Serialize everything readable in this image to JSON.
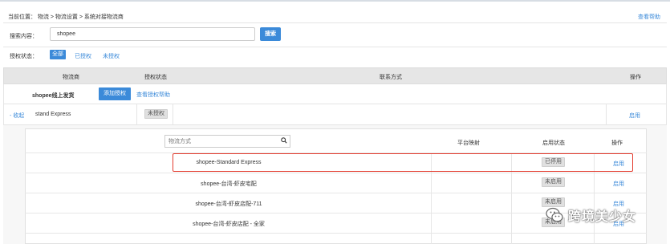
{
  "breadcrumb": "当前位置： 物流 > 物流设置 > 系统对接物流商",
  "help_link": "查看帮助",
  "search": {
    "label": "搜索内容：",
    "value": "shopee",
    "button": "搜索"
  },
  "auth_filter": {
    "label": "授权状态：",
    "options": [
      "全部",
      "已授权",
      "未授权"
    ],
    "selected": "全部"
  },
  "table": {
    "headers": [
      "物流商",
      "授权状态",
      "联系方式",
      "操作"
    ]
  },
  "provider": {
    "name": "shopee线上发货",
    "add_auth_button": "添加授权",
    "auth_help_link": "查看授权帮助"
  },
  "express_row": {
    "collapse_link": "- 收起",
    "name": "stand Express",
    "status": "未授权",
    "action": "启用"
  },
  "inner_table": {
    "search_placeholder": "物流方式",
    "headers": [
      "平台映射",
      "启用状态",
      "操作"
    ],
    "rows": [
      {
        "name": "shopee-Standard Express",
        "status": "已停用",
        "action": "启用"
      },
      {
        "name": "shopee-台湾-虾皮宅配",
        "status": "未启用",
        "action": "启用"
      },
      {
        "name": "shopee-台湾-虾皮店配-711",
        "status": "未启用",
        "action": "启用"
      },
      {
        "name": "shopee-台湾-虾皮店配 - 全家",
        "status": "未启用",
        "action": "启用"
      }
    ]
  },
  "watermark": "跨境美少女",
  "colors": {
    "accent": "#3b8ad9",
    "highlight_border": "#e33c2f",
    "header_bg": "#e6e6e6"
  }
}
